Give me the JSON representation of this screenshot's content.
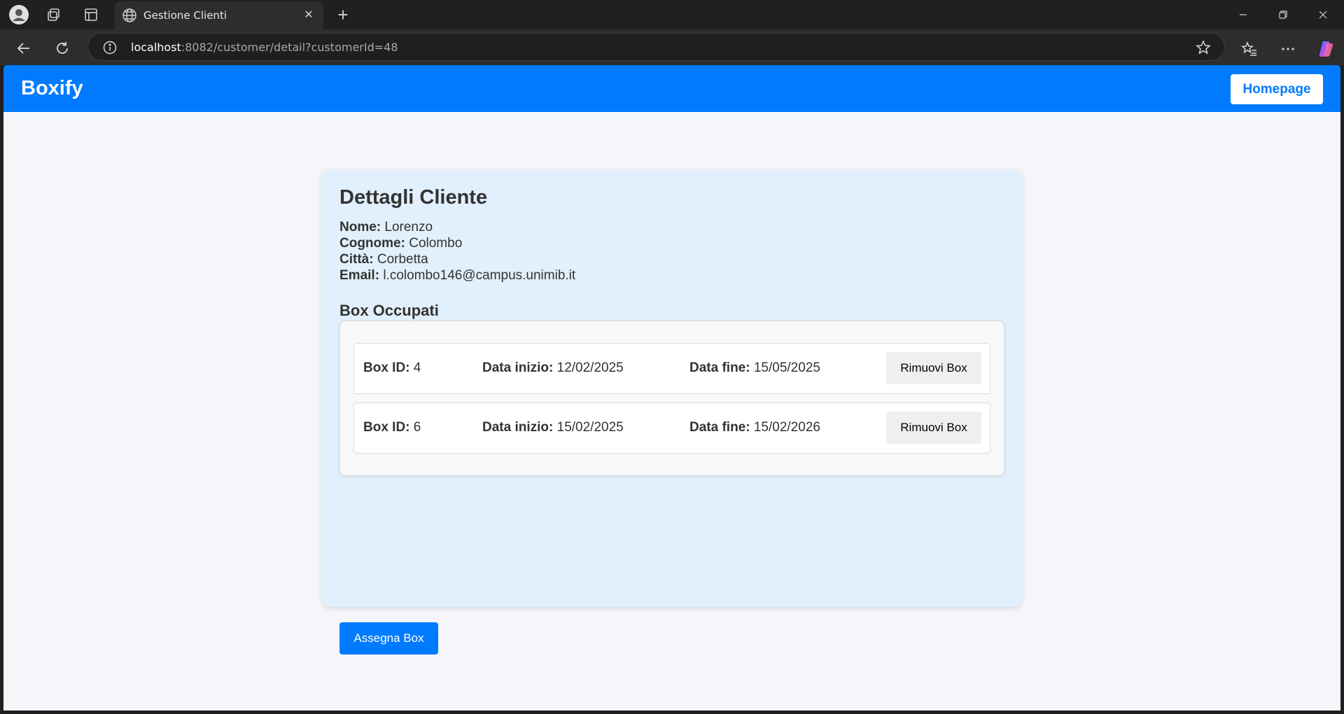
{
  "browser": {
    "tab_title": "Gestione Clienti",
    "url_host": "localhost",
    "url_path": ":8082/customer/detail?customerId=48"
  },
  "app": {
    "brand": "Boxify",
    "homepage_label": "Homepage",
    "accent_color": "#007bff"
  },
  "customer": {
    "title": "Dettagli Cliente",
    "fields": [
      {
        "label": "Nome:",
        "value": "Lorenzo"
      },
      {
        "label": "Cognome:",
        "value": "Colombo"
      },
      {
        "label": "Città:",
        "value": "Corbetta"
      },
      {
        "label": "Email:",
        "value": "l.colombo146@campus.unimib.it"
      }
    ]
  },
  "boxes": {
    "title": "Box Occupati",
    "id_label": "Box ID:",
    "start_label": "Data inizio:",
    "end_label": "Data fine:",
    "remove_label": "Rimuovi Box",
    "rows": [
      {
        "id": "4",
        "start": "12/02/2025",
        "end": "15/05/2025"
      },
      {
        "id": "6",
        "start": "15/02/2025",
        "end": "15/02/2026"
      }
    ]
  },
  "assign_label": "Assegna Box"
}
